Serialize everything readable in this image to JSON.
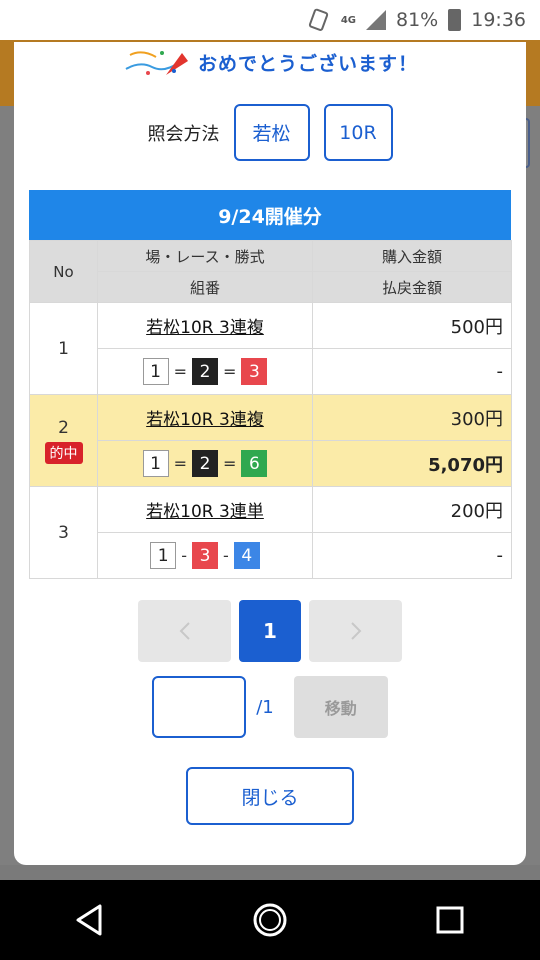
{
  "status": {
    "network": "4G",
    "battery": "81%",
    "time": "19:36"
  },
  "modal": {
    "congrats": "おめでとうございます！",
    "lookup": {
      "label": "照会方法",
      "venue": "若松",
      "race": "10R"
    },
    "table": {
      "heading": "9/24開催分",
      "headers": {
        "no": "No",
        "race": "場・レース・勝式",
        "purchase": "購入金額",
        "combo": "組番",
        "payout": "払戻金額"
      },
      "rows": [
        {
          "no": "1",
          "race": "若松10R 3連複",
          "boats": [
            "1",
            "2",
            "3"
          ],
          "seps": [
            "=",
            "="
          ],
          "purchase": "500円",
          "payout": "-",
          "hit": ""
        },
        {
          "no": "2",
          "race": "若松10R 3連複",
          "boats": [
            "1",
            "2",
            "6"
          ],
          "seps": [
            "=",
            "="
          ],
          "purchase": "300円",
          "payout": "5,070円",
          "hit": "的中"
        },
        {
          "no": "3",
          "race": "若松10R 3連単",
          "boats": [
            "1",
            "3",
            "4"
          ],
          "seps": [
            "-",
            "-"
          ],
          "purchase": "200円",
          "payout": "-",
          "hit": ""
        }
      ]
    },
    "pager": {
      "current": "1",
      "total": "/1",
      "move": "移動"
    },
    "close": "閉じる"
  },
  "colors": {
    "accent": "#1b5fd0",
    "header_blue": "#1f86e8",
    "hit_row": "#fbeba8",
    "hit_badge": "#d8232a",
    "boat_1": "#ffffff",
    "boat_2": "#222222",
    "boat_3": "#e8474d",
    "boat_4": "#3c86e6",
    "boat_6": "#2fa84f"
  }
}
